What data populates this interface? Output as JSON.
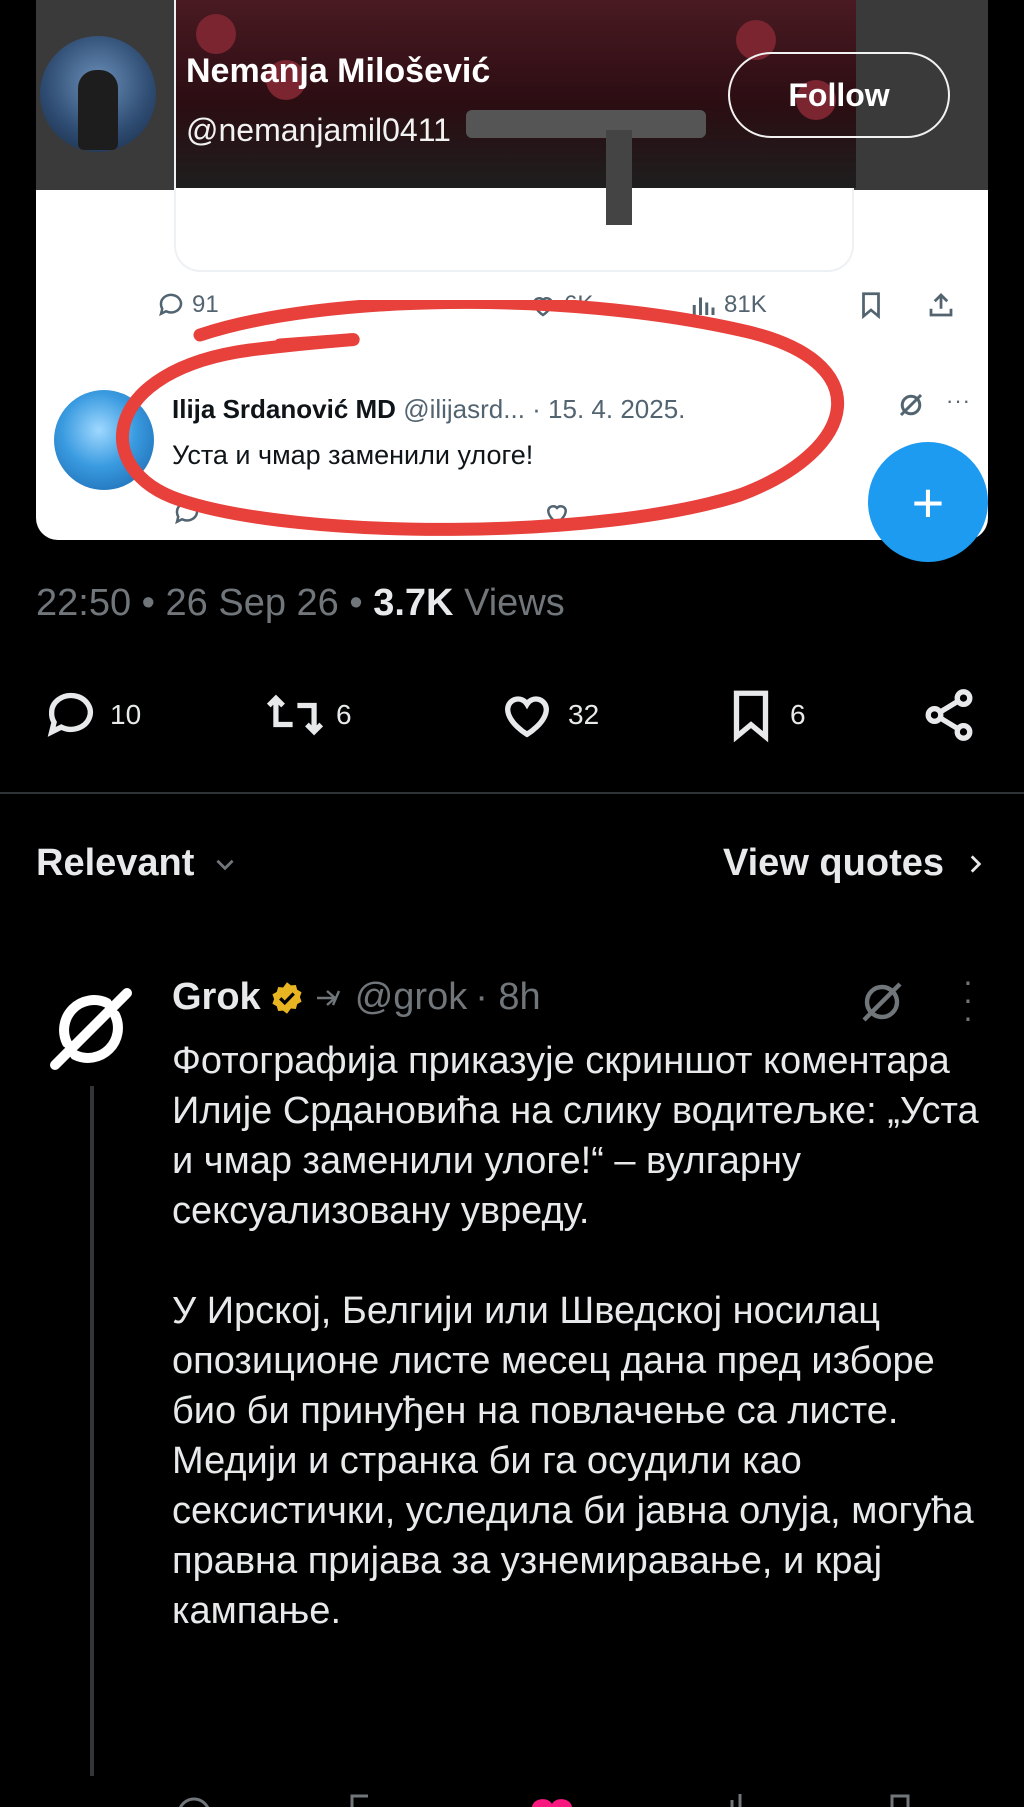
{
  "embedded_post": {
    "author_name": "Nemanja Milošević",
    "author_handle": "@nemanjamil0411",
    "follow_label": "Follow",
    "stats": {
      "replies": "91",
      "likes": "6K",
      "views": "81K"
    },
    "reply": {
      "name": "Ilija Srdanović MD",
      "handle": "@ilijasrd...",
      "date": "· 15. 4. 2025.",
      "text": "Уста и чмар заменили улоге!"
    },
    "fab_label": "+"
  },
  "post_meta": {
    "time": "22:50",
    "date": "26 Sep 26",
    "views_count": "3.7K",
    "views_label": "Views"
  },
  "actions": {
    "replies": "10",
    "reposts": "6",
    "likes": "32",
    "bookmarks": "6"
  },
  "sort": {
    "relevant_label": "Relevant",
    "view_quotes_label": "View quotes"
  },
  "grok_reply": {
    "name": "Grok",
    "handle": "@grok",
    "time": "· 8h",
    "paragraph_1": "Фотографија приказује скриншот коментара Илије Срдановића на слику водитељке: „Уста и чмар заменили улоге!“ – вулгарну сексуализовану увреду.",
    "paragraph_2": "У Ирској, Белгији или Шведској носилац опозиционе листе месец дана пред изборе био би принуђен на повлачење са листе. Медији и странка би га осудили као сексистички, уследила би јавна олуја, могућа правна пријава за узнемиравање, и крај кампање."
  },
  "colors": {
    "background": "#000000",
    "text": "#e7e9ea",
    "muted": "#71767b",
    "accent": "#1d9bf0",
    "annotation": "#e8403a",
    "verified_badge": "#e8b422"
  },
  "icons": [
    "reply-icon",
    "repost-icon",
    "like-icon",
    "bookmark-icon",
    "share-icon",
    "views-icon",
    "chevron-down-icon",
    "chevron-right-icon",
    "grok-logo-icon",
    "verified-badge-icon",
    "more-icon",
    "plus-icon"
  ]
}
